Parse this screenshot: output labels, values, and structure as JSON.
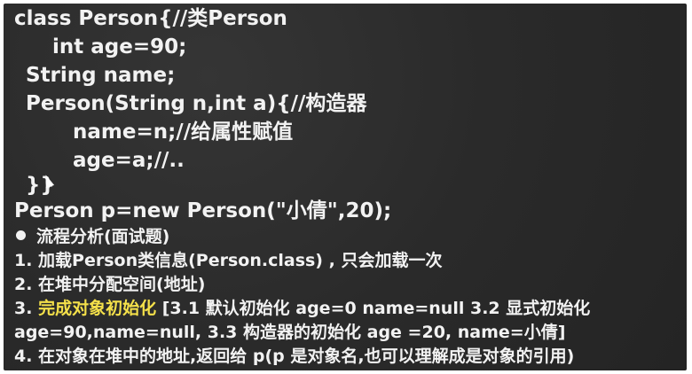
{
  "code": {
    "line1": "class Person{//类Person",
    "line2": "int age=90;",
    "line3": "String name;",
    "line4": "Person(String n,int a){//构造器",
    "line5": "name=n;//给属性赋值",
    "line6": "age=a;//..",
    "line7": "}}",
    "line8": "Person p=new Person(\"小倩\",20);"
  },
  "analysis": {
    "heading": "流程分析(面试题)",
    "step1": "1. 加载Person类信息(Person.class) , 只会加载一次",
    "step2": "2. 在堆中分配空间(地址)",
    "step3_prefix": "3. ",
    "step3_highlight": "完成对象初始化",
    "step3_rest": " [3.1 默认初始化 age=0 name=null 3.2 显式初始化",
    "step3_cont": "age=90,name=null, 3.3 构造器的初始化 age =20, name=小倩]",
    "step4": "4. 在对象在堆中的地址,返回给 p(p 是对象名,也可以理解成是对象的引用)"
  },
  "colors": {
    "background": "#2c2c2c",
    "text": "#f2f2f2",
    "highlight": "#f4e04a"
  }
}
